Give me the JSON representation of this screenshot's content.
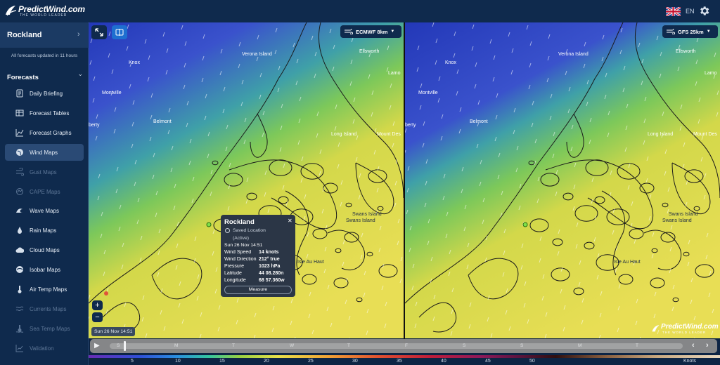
{
  "app": {
    "brand": "PredictWind.com",
    "tagline": "THE WORLD LEADER",
    "language": "EN"
  },
  "sidebar": {
    "location": "Rockland",
    "updated": "All forecasts updated in 11 hours",
    "section_title": "Forecasts",
    "items": [
      {
        "label": "Daily Briefing",
        "icon": "briefing-icon",
        "state": "normal"
      },
      {
        "label": "Forecast Tables",
        "icon": "table-icon",
        "state": "normal"
      },
      {
        "label": "Forecast Graphs",
        "icon": "graph-icon",
        "state": "normal"
      },
      {
        "label": "Wind Maps",
        "icon": "globe-icon",
        "state": "active"
      },
      {
        "label": "Gust Maps",
        "icon": "gust-icon",
        "state": "disabled"
      },
      {
        "label": "CAPE Maps",
        "icon": "cape-icon",
        "state": "disabled"
      },
      {
        "label": "Wave Maps",
        "icon": "wave-icon",
        "state": "normal"
      },
      {
        "label": "Rain Maps",
        "icon": "rain-icon",
        "state": "normal"
      },
      {
        "label": "Cloud Maps",
        "icon": "cloud-icon",
        "state": "normal"
      },
      {
        "label": "Isobar Maps",
        "icon": "isobar-icon",
        "state": "normal"
      },
      {
        "label": "Air Temp Maps",
        "icon": "thermometer-icon",
        "state": "normal"
      },
      {
        "label": "Currents Maps",
        "icon": "currents-icon",
        "state": "disabled"
      },
      {
        "label": "Sea Temp Maps",
        "icon": "sea-temp-icon",
        "state": "disabled"
      },
      {
        "label": "Validation",
        "icon": "validation-icon",
        "state": "disabled"
      }
    ]
  },
  "maps": {
    "left_model": "ECMWF 8km",
    "right_model": "GFS 25km",
    "places_left": [
      "Verona Island",
      "Ellsworth",
      "Knox",
      "Lamo",
      "Montville",
      "Belmont",
      "berty",
      "Long Island",
      "Mount Des",
      "Swans Island",
      "Swans Island",
      "Isle Au Haut"
    ],
    "places_right": [
      "Verona Island",
      "Ellsworth",
      "Knox",
      "Lamo",
      "Montville",
      "Belmont",
      "berty",
      "Long Island",
      "Mount Des",
      "Swans Island",
      "Swans Island",
      "Isle Au Haut"
    ]
  },
  "popup": {
    "title": "Rockland",
    "saved": "Saved Location",
    "active": "(Active)",
    "datetime": "Sun 26 Nov 14:51",
    "rows": [
      {
        "label": "Wind Speed",
        "value": "14 knots"
      },
      {
        "label": "Wind Direction",
        "value": "212° true"
      },
      {
        "label": "Pressure",
        "value": "1023 hPa"
      },
      {
        "label": "Latitude",
        "value": "44 08.280n"
      },
      {
        "label": "Longitude",
        "value": "68 57.360w"
      }
    ],
    "measure": "Measure"
  },
  "timestamp": "Sun 26 Nov 14:51",
  "timeline": {
    "progress": 0.025,
    "days_left": [
      "S",
      "M",
      "T",
      "W",
      "T"
    ],
    "days_right": [
      "F",
      "S",
      "S",
      "M",
      "T"
    ]
  },
  "legend": {
    "values": [
      "5",
      "10",
      "15",
      "20",
      "25",
      "30",
      "35",
      "40",
      "45",
      "50"
    ],
    "units": "Knots"
  }
}
